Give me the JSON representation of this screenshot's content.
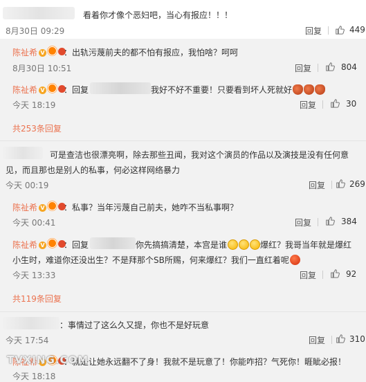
{
  "comments": [
    {
      "text": "看着你才像个恶妇吧，当心有报应！！！",
      "time": "8月30日 09:29",
      "reply": "回复",
      "likes": "449"
    },
    {
      "name": "陈祉希",
      "text": "：出轨污蔑前夫的都不怕有报应，我怕啥？呵呵",
      "time": "8月30日 10:51",
      "reply": "回复",
      "likes": "804"
    },
    {
      "name": "陈祉希",
      "text_prefix": "：回复",
      "text": "我好不好不重要！只要看到坏人死就好",
      "time": "今天 18:19",
      "reply": "回复",
      "likes": "30"
    },
    {
      "total": "共253条回复"
    },
    {
      "text_line1": "可是查洁也很漂亮啊，除去那些丑闻，我对这个演员的作品以及演技是没有任何意",
      "text_line2": "见，而且那也是别人的私事，何必这样网络暴力",
      "time": "今天 00:19",
      "reply": "回复",
      "likes": "269"
    },
    {
      "name": "陈祉希",
      "text": "：私事？当年污蔑自己前夫，她咋不当私事啊？",
      "time": "今天 00:41",
      "reply": "回复",
      "likes": "384"
    },
    {
      "name": "陈祉希",
      "text_prefix": "：回复",
      "text_a": "你先搞搞清楚，本宫是谁",
      "text_b": "爆红？我哥当年就是爆红",
      "text_line2a": "小生时，难道你还没出生？不是拜那个SB所赐，何来爆红？我们一直红着呢",
      "time": "今天 13:33",
      "reply": "回复",
      "likes": "92"
    },
    {
      "total": "共119条回复"
    },
    {
      "text": "：事情过了这么久又提，你也不是好玩意",
      "time": "今天 17:54",
      "reply": "回复",
      "likes": "310"
    },
    {
      "name": "陈祉希",
      "text": "：就是让她永远翻不了身！我就不是玩意了！你能咋招？气死你！睚眦必报！",
      "time": "今天 18:18"
    }
  ],
  "watermark": "TVXING.COM",
  "colors": {
    "name": "#eb7350",
    "total": "#eb7350",
    "bg": "#f2f2f2"
  }
}
